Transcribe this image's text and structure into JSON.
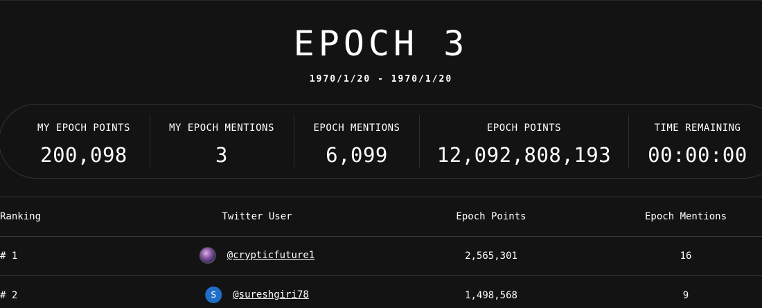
{
  "header": {
    "title": "EPOCH 3",
    "date_range": "1970/1/20 - 1970/1/20"
  },
  "stats": [
    {
      "label": "MY EPOCH POINTS",
      "value": "200,098"
    },
    {
      "label": "MY EPOCH MENTIONS",
      "value": "3"
    },
    {
      "label": "EPOCH MENTIONS",
      "value": "6,099"
    },
    {
      "label": "EPOCH POINTS",
      "value": "12,092,808,193"
    },
    {
      "label": "TIME REMAINING",
      "value": "00:00:00"
    }
  ],
  "table": {
    "columns": [
      "Ranking",
      "Twitter User",
      "Epoch Points",
      "Epoch Mentions"
    ],
    "rows": [
      {
        "rank": "# 1",
        "avatar": "",
        "handle": "@crypticfuture1",
        "points": "2,565,301",
        "mentions": "16"
      },
      {
        "rank": "# 2",
        "avatar": "S",
        "handle": "@sureshgiri78",
        "points": "1,498,568",
        "mentions": "9"
      }
    ]
  },
  "colors": {
    "background": "#131313",
    "text": "#ffffff",
    "border": "#353535",
    "avatar_blue": "#1f6fc8"
  }
}
